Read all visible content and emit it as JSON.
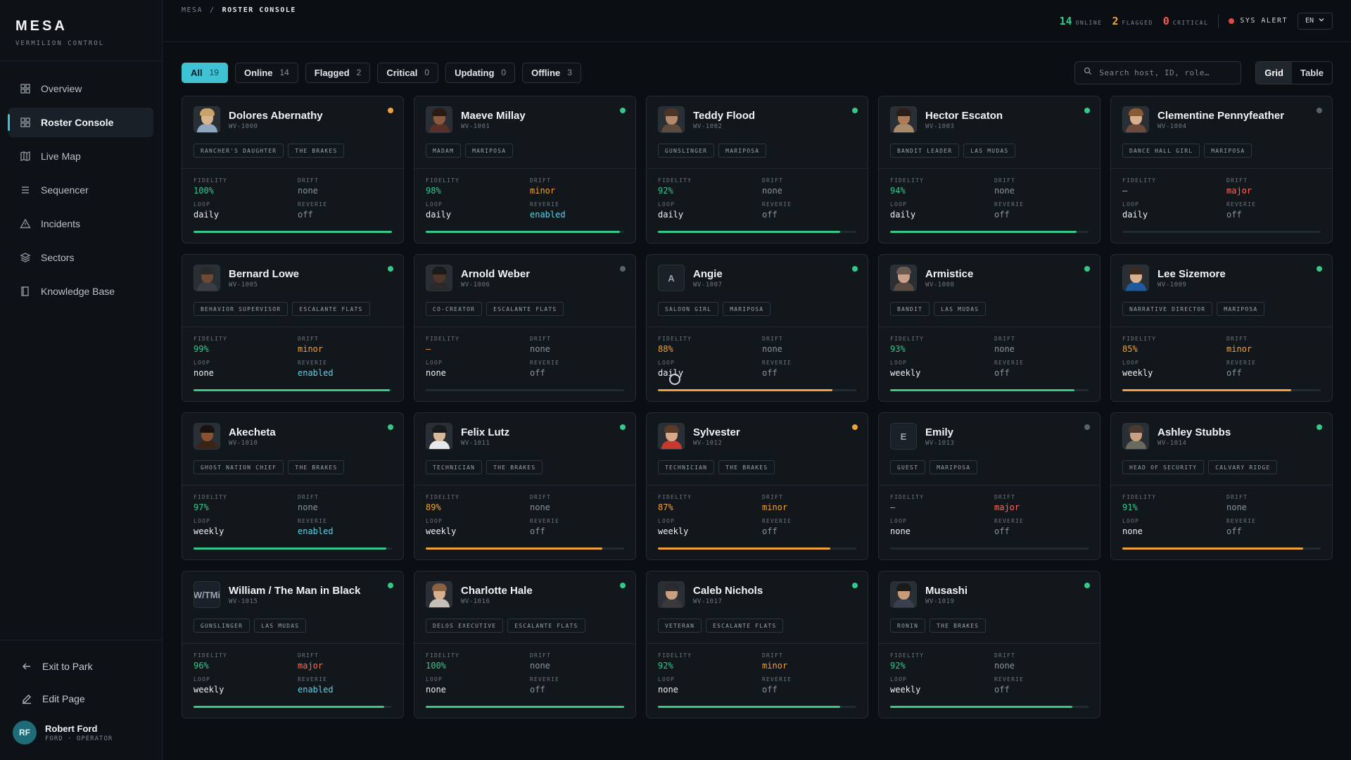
{
  "brand": {
    "title": "MESA",
    "subtitle": "VERMILION CONTROL"
  },
  "nav": [
    {
      "label": "Overview",
      "icon": "grid-icon",
      "active": false
    },
    {
      "label": "Roster Console",
      "icon": "grid-icon",
      "active": true
    },
    {
      "label": "Live Map",
      "icon": "map-icon",
      "active": false
    },
    {
      "label": "Sequencer",
      "icon": "list-icon",
      "active": false
    },
    {
      "label": "Incidents",
      "icon": "warning-icon",
      "active": false
    },
    {
      "label": "Sectors",
      "icon": "layers-icon",
      "active": false
    },
    {
      "label": "Knowledge Base",
      "icon": "book-icon",
      "active": false
    }
  ],
  "bottom_links": [
    {
      "label": "Exit to Park",
      "icon": "arrow-left-icon"
    },
    {
      "label": "Edit Page",
      "icon": "edit-icon"
    }
  ],
  "user": {
    "initials": "RF",
    "name": "Robert Ford",
    "role": "FORD · OPERATOR"
  },
  "breadcrumb": {
    "root": "MESA",
    "separator": "/",
    "current": "ROSTER CONSOLE"
  },
  "top_stats": [
    {
      "value": "14",
      "label": "ONLINE",
      "color": "#34c98a"
    },
    {
      "value": "2",
      "label": "FLAGGED",
      "color": "#f0a23a"
    },
    {
      "value": "0",
      "label": "CRITICAL",
      "color": "#ff5a4c"
    }
  ],
  "alert_label": "SYS ALERT",
  "language": "EN",
  "filters": [
    {
      "label": "All",
      "count": "19",
      "active": true
    },
    {
      "label": "Online",
      "count": "14",
      "active": false
    },
    {
      "label": "Flagged",
      "count": "2",
      "active": false
    },
    {
      "label": "Critical",
      "count": "0",
      "active": false
    },
    {
      "label": "Updating",
      "count": "0",
      "active": false
    },
    {
      "label": "Offline",
      "count": "3",
      "active": false
    }
  ],
  "search_placeholder": "Search host, ID, role…",
  "view_toggle": {
    "grid": "Grid",
    "table": "Table",
    "active": "grid"
  },
  "field_labels": {
    "fidelity": "FIDELITY",
    "drift": "DRIFT",
    "loop": "LOOP",
    "reverie": "REVERIE"
  },
  "status_colors": {
    "online": "#34c98a",
    "flagged": "#f0a23a",
    "offline": "#5a636c"
  },
  "hosts": [
    {
      "name": "Dolores Abernathy",
      "id": "WV-1000",
      "tags": [
        "RANCHER'S DAUGHTER",
        "THE BRAKES"
      ],
      "fidelity": "100%",
      "fidelity_tone": "green",
      "drift": "none",
      "drift_tone": "dim",
      "loop": "daily",
      "reverie": "off",
      "reverie_tone": "dim",
      "status": "flagged",
      "bar_fraction": 1.0,
      "bar_color": "#34c98a",
      "portrait": {
        "skin": "#d8b48e",
        "hair": "#c9a46a",
        "cloth": "#8fa6c0"
      }
    },
    {
      "name": "Maeve Millay",
      "id": "WV-1001",
      "tags": [
        "MADAM",
        "MARIPOSA"
      ],
      "fidelity": "98%",
      "fidelity_tone": "green",
      "drift": "minor",
      "drift_tone": "orange",
      "loop": "daily",
      "reverie": "enabled",
      "reverie_tone": "cyan",
      "status": "online",
      "bar_fraction": 0.98,
      "bar_color": "#34c98a",
      "portrait": {
        "skin": "#8a5a3e",
        "hair": "#2b1a12",
        "cloth": "#5a3128"
      }
    },
    {
      "name": "Teddy Flood",
      "id": "WV-1002",
      "tags": [
        "GUNSLINGER",
        "MARIPOSA"
      ],
      "fidelity": "92%",
      "fidelity_tone": "green",
      "drift": "none",
      "drift_tone": "dim",
      "loop": "daily",
      "reverie": "off",
      "reverie_tone": "dim",
      "status": "online",
      "bar_fraction": 0.92,
      "bar_color": "#34c98a",
      "portrait": {
        "skin": "#b58a6a",
        "hair": "#4a3526",
        "cloth": "#5d4a3c"
      }
    },
    {
      "name": "Hector Escaton",
      "id": "WV-1003",
      "tags": [
        "BANDIT LEADER",
        "LAS MUDAS"
      ],
      "fidelity": "94%",
      "fidelity_tone": "green",
      "drift": "none",
      "drift_tone": "dim",
      "loop": "daily",
      "reverie": "off",
      "reverie_tone": "dim",
      "status": "online",
      "bar_fraction": 0.94,
      "bar_color": "#34c98a",
      "portrait": {
        "skin": "#b07a55",
        "hair": "#2a1e16",
        "cloth": "#a98a6a"
      }
    },
    {
      "name": "Clementine Pennyfeather",
      "id": "WV-1004",
      "tags": [
        "DANCE HALL GIRL",
        "MARIPOSA"
      ],
      "fidelity": "—",
      "fidelity_tone": "orange",
      "drift": "major",
      "drift_tone": "red",
      "loop": "daily",
      "reverie": "off",
      "reverie_tone": "dim",
      "status": "offline",
      "bar_fraction": 0,
      "bar_color": "#34c98a",
      "portrait": {
        "skin": "#d9b08e",
        "hair": "#8a5a34",
        "cloth": "#6e4a3a"
      }
    },
    {
      "name": "Bernard Lowe",
      "id": "WV-1005",
      "tags": [
        "BEHAVIOR SUPERVISOR",
        "ESCALANTE FLATS"
      ],
      "fidelity": "99%",
      "fidelity_tone": "green",
      "drift": "minor",
      "drift_tone": "orange",
      "loop": "none",
      "reverie": "enabled",
      "reverie_tone": "cyan",
      "status": "online",
      "bar_fraction": 0.99,
      "bar_color": "#34c98a",
      "portrait": {
        "skin": "#6e4a34",
        "hair": "#2a2a2a",
        "cloth": "#3a3e44"
      }
    },
    {
      "name": "Arnold Weber",
      "id": "WV-1006",
      "tags": [
        "CO-CREATOR",
        "ESCALANTE FLATS"
      ],
      "fidelity": "—",
      "fidelity_tone": "orange",
      "drift": "none",
      "drift_tone": "dim",
      "loop": "none",
      "reverie": "off",
      "reverie_tone": "dim",
      "status": "offline",
      "bar_fraction": 0,
      "bar_color": "#34c98a",
      "portrait": {
        "skin": "#4e3628",
        "hair": "#1a1a1a",
        "cloth": "#2a2a2a"
      }
    },
    {
      "name": "Angie",
      "id": "WV-1007",
      "tags": [
        "SALOON GIRL",
        "MARIPOSA"
      ],
      "fidelity": "88%",
      "fidelity_tone": "orange",
      "drift": "none",
      "drift_tone": "dim",
      "loop": "daily",
      "reverie": "off",
      "reverie_tone": "dim",
      "status": "online",
      "bar_fraction": 0.88,
      "bar_color": "#f0a23a",
      "letter": "A"
    },
    {
      "name": "Armistice",
      "id": "WV-1008",
      "tags": [
        "BANDIT",
        "LAS MUDAS"
      ],
      "fidelity": "93%",
      "fidelity_tone": "green",
      "drift": "none",
      "drift_tone": "dim",
      "loop": "weekly",
      "reverie": "off",
      "reverie_tone": "dim",
      "status": "online",
      "bar_fraction": 0.93,
      "bar_color": "#34c98a",
      "portrait": {
        "skin": "#c9a08a",
        "hair": "#6a5a50",
        "cloth": "#5a4a40"
      }
    },
    {
      "name": "Lee Sizemore",
      "id": "WV-1009",
      "tags": [
        "NARRATIVE DIRECTOR",
        "MARIPOSA"
      ],
      "fidelity": "85%",
      "fidelity_tone": "orange",
      "drift": "minor",
      "drift_tone": "orange",
      "loop": "weekly",
      "reverie": "off",
      "reverie_tone": "dim",
      "status": "online",
      "bar_fraction": 0.85,
      "bar_color": "#f0a23a",
      "portrait": {
        "skin": "#d8b090",
        "hair": "#3a2a20",
        "cloth": "#1e5a9a"
      }
    },
    {
      "name": "Akecheta",
      "id": "WV-1010",
      "tags": [
        "GHOST NATION CHIEF",
        "THE BRAKES"
      ],
      "fidelity": "97%",
      "fidelity_tone": "green",
      "drift": "none",
      "drift_tone": "dim",
      "loop": "weekly",
      "reverie": "enabled",
      "reverie_tone": "cyan",
      "status": "online",
      "bar_fraction": 0.97,
      "bar_color": "#34c98a",
      "portrait": {
        "skin": "#8a5030",
        "hair": "#1a1210",
        "cloth": "#3a2418"
      }
    },
    {
      "name": "Felix Lutz",
      "id": "WV-1011",
      "tags": [
        "TECHNICIAN",
        "THE BRAKES"
      ],
      "fidelity": "89%",
      "fidelity_tone": "orange",
      "drift": "none",
      "drift_tone": "dim",
      "loop": "weekly",
      "reverie": "off",
      "reverie_tone": "dim",
      "status": "online",
      "bar_fraction": 0.89,
      "bar_color": "#f0a23a",
      "portrait": {
        "skin": "#d8b898",
        "hair": "#1a1a1a",
        "cloth": "#e8e8e8"
      }
    },
    {
      "name": "Sylvester",
      "id": "WV-1012",
      "tags": [
        "TECHNICIAN",
        "THE BRAKES"
      ],
      "fidelity": "87%",
      "fidelity_tone": "orange",
      "drift": "minor",
      "drift_tone": "orange",
      "loop": "weekly",
      "reverie": "off",
      "reverie_tone": "dim",
      "status": "flagged",
      "bar_fraction": 0.87,
      "bar_color": "#f0a23a",
      "portrait": {
        "skin": "#d8a888",
        "hair": "#5a3a28",
        "cloth": "#c83a30"
      }
    },
    {
      "name": "Emily",
      "id": "WV-1013",
      "tags": [
        "GUEST",
        "MARIPOSA"
      ],
      "fidelity": "—",
      "fidelity_tone": "orange",
      "drift": "major",
      "drift_tone": "red",
      "loop": "none",
      "reverie": "off",
      "reverie_tone": "dim",
      "status": "offline",
      "bar_fraction": 0,
      "bar_color": "#34c98a",
      "letter": "E"
    },
    {
      "name": "Ashley Stubbs",
      "id": "WV-1014",
      "tags": [
        "HEAD OF SECURITY",
        "CALVARY RIDGE"
      ],
      "fidelity": "91%",
      "fidelity_tone": "green",
      "drift": "none",
      "drift_tone": "dim",
      "loop": "none",
      "reverie": "off",
      "reverie_tone": "dim",
      "status": "online",
      "bar_fraction": 0.91,
      "bar_color": "#f0a23a",
      "portrait": {
        "skin": "#c8a080",
        "hair": "#4a3a30",
        "cloth": "#6a6a60"
      }
    },
    {
      "name": "William / The Man in Black",
      "id": "WV-1015",
      "tags": [
        "GUNSLINGER",
        "LAS MUDAS"
      ],
      "fidelity": "96%",
      "fidelity_tone": "green",
      "drift": "major",
      "drift_tone": "red",
      "loop": "weekly",
      "reverie": "enabled",
      "reverie_tone": "cyan",
      "status": "online",
      "bar_fraction": 0.96,
      "bar_color": "#34c98a",
      "letter": "W/TMi"
    },
    {
      "name": "Charlotte Hale",
      "id": "WV-1016",
      "tags": [
        "DELOS EXECUTIVE",
        "ESCALANTE FLATS"
      ],
      "fidelity": "100%",
      "fidelity_tone": "green",
      "drift": "none",
      "drift_tone": "dim",
      "loop": "none",
      "reverie": "off",
      "reverie_tone": "dim",
      "status": "online",
      "bar_fraction": 1.0,
      "bar_color": "#34c98a",
      "portrait": {
        "skin": "#d8b090",
        "hair": "#8a6040",
        "cloth": "#c8c0b8"
      }
    },
    {
      "name": "Caleb Nichols",
      "id": "WV-1017",
      "tags": [
        "VETERAN",
        "ESCALANTE FLATS"
      ],
      "fidelity": "92%",
      "fidelity_tone": "green",
      "drift": "minor",
      "drift_tone": "orange",
      "loop": "none",
      "reverie": "off",
      "reverie_tone": "dim",
      "status": "online",
      "bar_fraction": 0.92,
      "bar_color": "#34c98a",
      "portrait": {
        "skin": "#c8a080",
        "hair": "#2a2a2a",
        "cloth": "#3a3a3a"
      }
    },
    {
      "name": "Musashi",
      "id": "WV-1019",
      "tags": [
        "RONIN",
        "THE BRAKES"
      ],
      "fidelity": "92%",
      "fidelity_tone": "green",
      "drift": "none",
      "drift_tone": "dim",
      "loop": "weekly",
      "reverie": "off",
      "reverie_tone": "dim",
      "status": "online",
      "bar_fraction": 0.92,
      "bar_color": "#34c98a",
      "portrait": {
        "skin": "#c89a78",
        "hair": "#1a1a1a",
        "cloth": "#3a4050"
      }
    }
  ]
}
